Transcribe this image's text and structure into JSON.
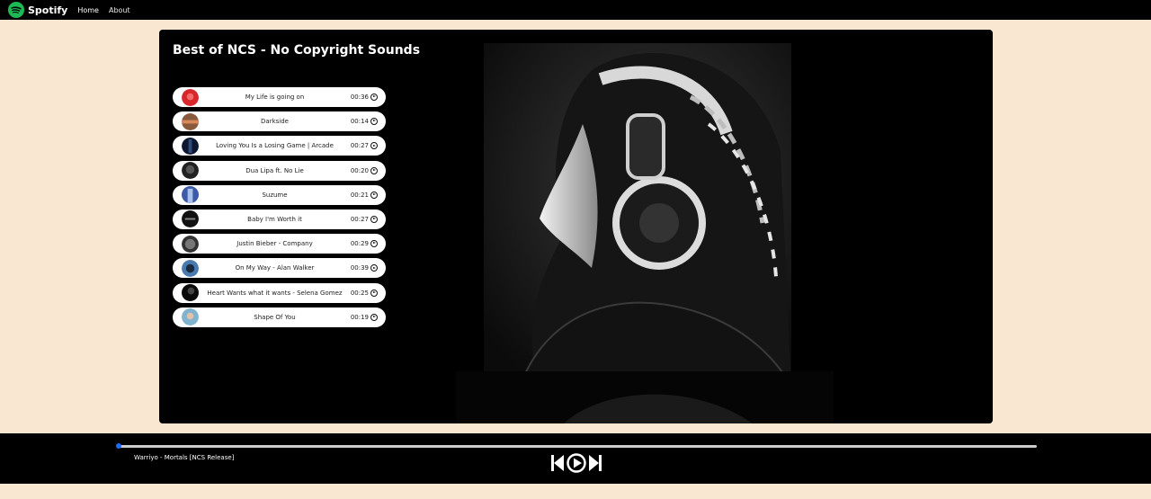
{
  "navbar": {
    "brand": "Spotify",
    "logo_icon": "spotify-logo-icon",
    "links": [
      "Home",
      "About"
    ]
  },
  "colors": {
    "page_bg": "#f9e7d2",
    "brand_green": "#1db954",
    "progress": "#1e6bff"
  },
  "playlist": {
    "title": "Best of NCS - No Copyright Sounds",
    "songs": [
      {
        "name": "My Life is going on",
        "duration": "00:36"
      },
      {
        "name": "Darkside",
        "duration": "00:14"
      },
      {
        "name": "Loving You Is a Losing Game | Arcade",
        "duration": "00:27"
      },
      {
        "name": "Dua Lipa ft. No Lie",
        "duration": "00:20"
      },
      {
        "name": "Suzume",
        "duration": "00:21"
      },
      {
        "name": "Baby I'm Worth it",
        "duration": "00:27"
      },
      {
        "name": "Justin Bieber - Company",
        "duration": "00:29"
      },
      {
        "name": "On My Way - Alan Walker",
        "duration": "00:39"
      },
      {
        "name": "Heart Wants what it wants - Selena Gomez",
        "duration": "00:25"
      },
      {
        "name": "Shape Of You",
        "duration": "00:19"
      }
    ]
  },
  "player": {
    "now_playing": "Warriyo - Mortals [NCS Release]",
    "progress": 0,
    "controls": [
      "previous-icon",
      "play-icon",
      "next-icon"
    ]
  }
}
